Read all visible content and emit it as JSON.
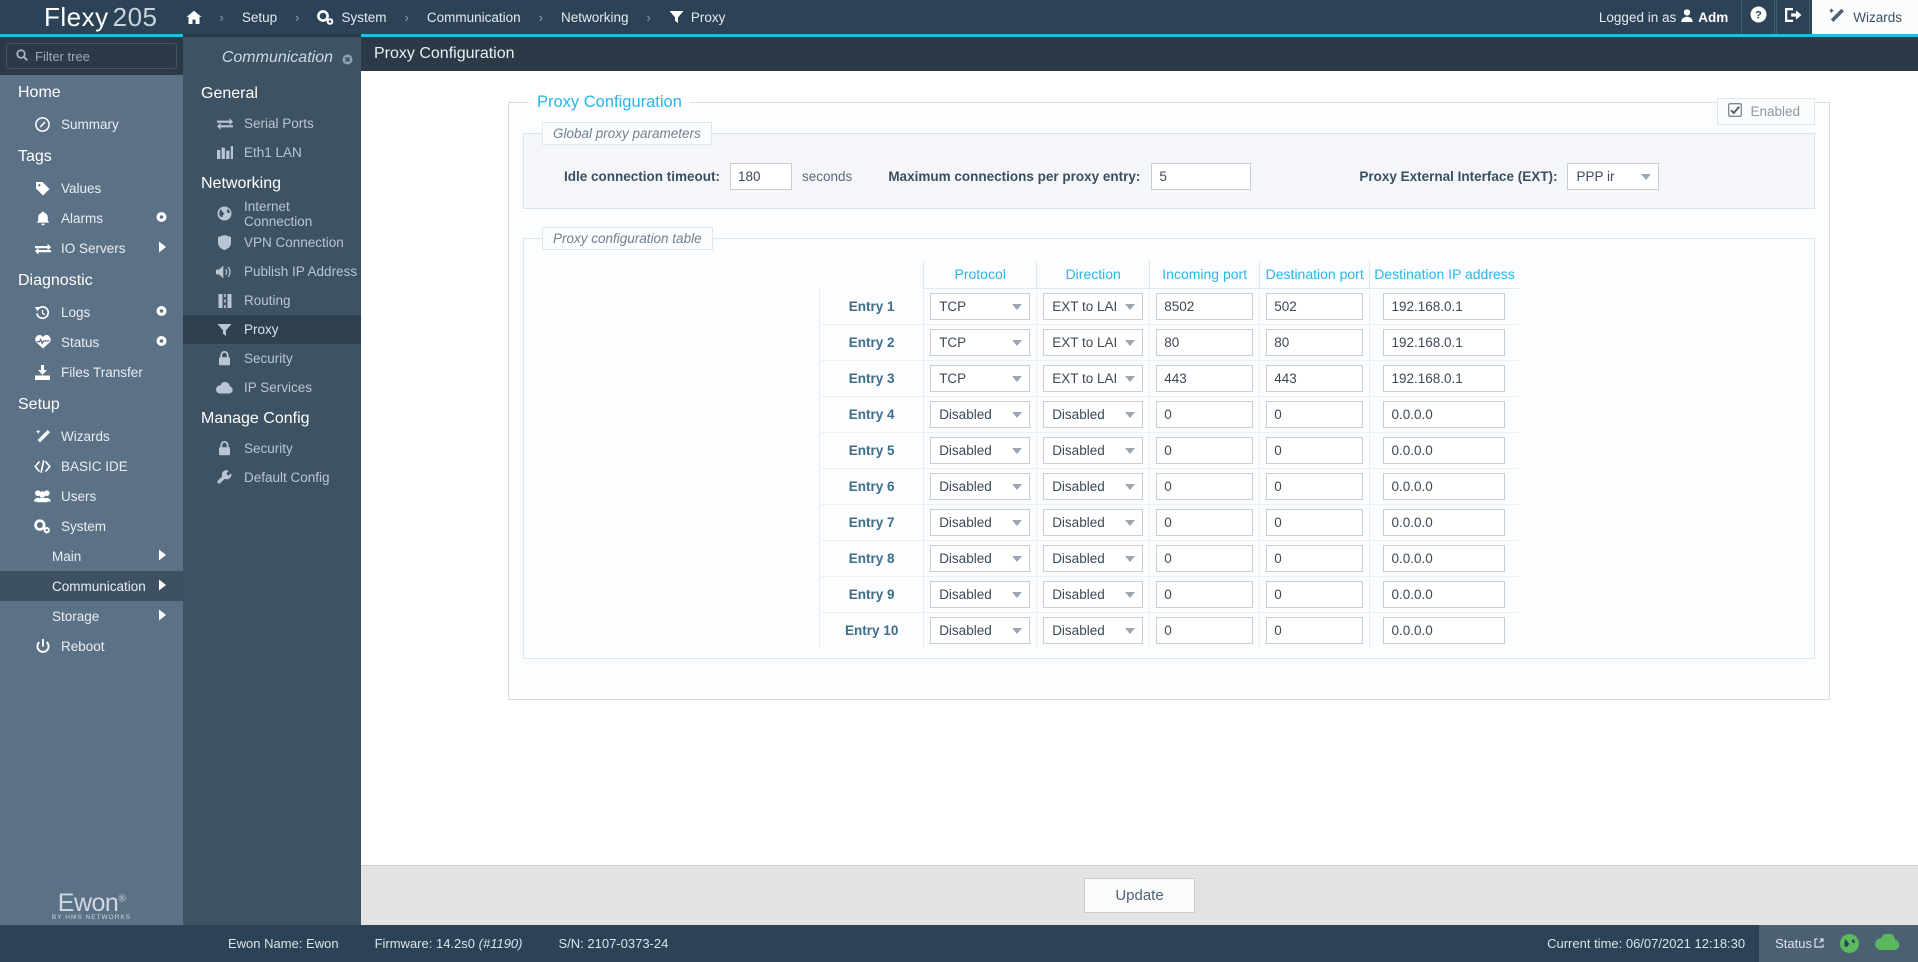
{
  "header": {
    "brand_primary": "Flexy",
    "brand_secondary": "205",
    "breadcrumbs": [
      {
        "label": "",
        "icon": "home-icon"
      },
      {
        "label": "Setup",
        "icon": ""
      },
      {
        "label": "System",
        "icon": "gears-icon"
      },
      {
        "label": "Communication",
        "icon": ""
      },
      {
        "label": "Networking",
        "icon": ""
      },
      {
        "label": "Proxy",
        "icon": "filter-icon"
      }
    ],
    "separator": "›",
    "logged_in_prefix": "Logged in as",
    "logged_in_user": "Adm",
    "help_icon": "question-mark-icon",
    "logout_icon": "logout-icon",
    "wizards_label": "Wizards",
    "wizards_icon": "magic-wand-icon"
  },
  "sidebar": {
    "filter_placeholder": "Filter tree",
    "filter_value": "",
    "search_icon": "search-icon",
    "groups": [
      {
        "label": "Home",
        "items": [
          {
            "label": "Summary",
            "icon": "dashboard-icon",
            "badge": ""
          }
        ]
      },
      {
        "label": "Tags",
        "items": [
          {
            "label": "Values",
            "icon": "tag-icon",
            "badge": ""
          },
          {
            "label": "Alarms",
            "icon": "bell-icon",
            "badge": "gear-badge"
          },
          {
            "label": "IO Servers",
            "icon": "exchange-icon",
            "badge": "arrow-badge"
          }
        ]
      },
      {
        "label": "Diagnostic",
        "items": [
          {
            "label": "Logs",
            "icon": "history-icon",
            "badge": "gear-badge"
          },
          {
            "label": "Status",
            "icon": "heartbeat-icon",
            "badge": "gear-badge"
          },
          {
            "label": "Files Transfer",
            "icon": "download-icon",
            "badge": ""
          }
        ]
      },
      {
        "label": "Setup",
        "items": [
          {
            "label": "Wizards",
            "icon": "magic-wand-icon",
            "badge": ""
          },
          {
            "label": "BASIC IDE",
            "icon": "code-icon",
            "badge": ""
          },
          {
            "label": "Users",
            "icon": "users-icon",
            "badge": ""
          },
          {
            "label": "System",
            "icon": "gears-icon",
            "badge": ""
          }
        ]
      }
    ],
    "system_subitems": [
      {
        "label": "Main",
        "badge": "arrow-badge",
        "active": false
      },
      {
        "label": "Communication",
        "badge": "arrow-badge",
        "active": true
      },
      {
        "label": "Storage",
        "badge": "arrow-badge",
        "active": false
      }
    ],
    "reboot": {
      "label": "Reboot",
      "icon": "power-icon"
    },
    "logo_text": "Ewon",
    "logo_sup": "®",
    "logo_tagline": "BY HMS NETWORKS"
  },
  "panel2": {
    "title": "Communication",
    "close_icon": "close-icon",
    "groups": [
      {
        "label": "General",
        "items": [
          {
            "label": "Serial Ports",
            "icon": "exchange-icon",
            "active": false
          },
          {
            "label": "Eth1 LAN",
            "icon": "chart-icon",
            "active": false
          }
        ]
      },
      {
        "label": "Networking",
        "items": [
          {
            "label": "Internet Connection",
            "icon": "globe-icon",
            "active": false
          },
          {
            "label": "VPN Connection",
            "icon": "shield-icon",
            "active": false
          },
          {
            "label": "Publish IP Address",
            "icon": "speaker-icon",
            "active": false
          },
          {
            "label": "Routing",
            "icon": "road-icon",
            "active": false
          },
          {
            "label": "Proxy",
            "icon": "filter-icon",
            "active": true
          },
          {
            "label": "Security",
            "icon": "lock-icon",
            "active": false
          },
          {
            "label": "IP Services",
            "icon": "cloud-icon",
            "active": false
          }
        ]
      },
      {
        "label": "Manage Config",
        "items": [
          {
            "label": "Security",
            "icon": "lock-icon",
            "active": false
          },
          {
            "label": "Default Config",
            "icon": "wrench-icon",
            "active": false
          }
        ]
      }
    ]
  },
  "main": {
    "page_title": "Proxy Configuration",
    "legend": "Proxy Configuration",
    "enabled_label": "Enabled",
    "enabled_checked": true,
    "global": {
      "legend": "Global proxy parameters",
      "idle_label": "Idle connection timeout:",
      "idle_value": "180",
      "idle_units": "seconds",
      "maxconn_label": "Maximum connections per proxy entry:",
      "maxconn_value": "5",
      "ext_label": "Proxy External Interface (EXT):",
      "ext_value": "PPP ir"
    },
    "table": {
      "legend": "Proxy configuration table",
      "columns": [
        "",
        "Protocol",
        "Direction",
        "Incoming port",
        "Destination port",
        "Destination IP address"
      ],
      "rows": [
        {
          "entry": "Entry 1",
          "protocol": "TCP",
          "direction": "EXT to LAI",
          "incoming": "8502",
          "destination": "502",
          "ip": "192.168.0.1"
        },
        {
          "entry": "Entry 2",
          "protocol": "TCP",
          "direction": "EXT to LAI",
          "incoming": "80",
          "destination": "80",
          "ip": "192.168.0.1"
        },
        {
          "entry": "Entry 3",
          "protocol": "TCP",
          "direction": "EXT to LAI",
          "incoming": "443",
          "destination": "443",
          "ip": "192.168.0.1"
        },
        {
          "entry": "Entry 4",
          "protocol": "Disabled",
          "direction": "Disabled",
          "incoming": "0",
          "destination": "0",
          "ip": "0.0.0.0"
        },
        {
          "entry": "Entry 5",
          "protocol": "Disabled",
          "direction": "Disabled",
          "incoming": "0",
          "destination": "0",
          "ip": "0.0.0.0"
        },
        {
          "entry": "Entry 6",
          "protocol": "Disabled",
          "direction": "Disabled",
          "incoming": "0",
          "destination": "0",
          "ip": "0.0.0.0"
        },
        {
          "entry": "Entry 7",
          "protocol": "Disabled",
          "direction": "Disabled",
          "incoming": "0",
          "destination": "0",
          "ip": "0.0.0.0"
        },
        {
          "entry": "Entry 8",
          "protocol": "Disabled",
          "direction": "Disabled",
          "incoming": "0",
          "destination": "0",
          "ip": "0.0.0.0"
        },
        {
          "entry": "Entry 9",
          "protocol": "Disabled",
          "direction": "Disabled",
          "incoming": "0",
          "destination": "0",
          "ip": "0.0.0.0"
        },
        {
          "entry": "Entry 10",
          "protocol": "Disabled",
          "direction": "Disabled",
          "incoming": "0",
          "destination": "0",
          "ip": "0.0.0.0"
        }
      ]
    },
    "update_label": "Update"
  },
  "statusbar": {
    "ewon_name": "Ewon Name: Ewon",
    "firmware_label": "Firmware:",
    "firmware_value": "14.2s0",
    "firmware_build": "(#1190)",
    "serial": "S/N: 2107-0373-24",
    "current_time": "Current time: 06/07/2021 12:18:30",
    "status_label": "Status",
    "status_external_icon": "external-link-icon",
    "globe_icon": "globe-status-icon",
    "cloud_icon": "cloud-status-icon"
  },
  "colors": {
    "accent": "#29b6e8",
    "header_bg": "#2c4256",
    "sidebar1_bg": "#5b7186",
    "sidebar2_bg": "#3d5263",
    "status_green": "#5cb85c"
  }
}
